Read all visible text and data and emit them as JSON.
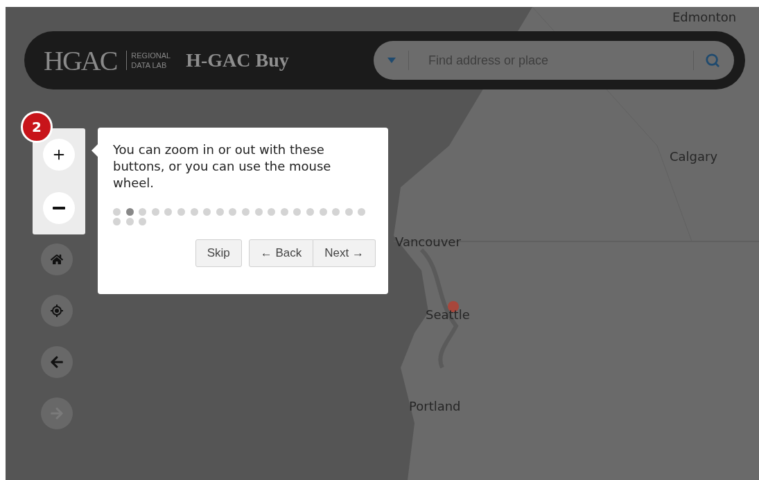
{
  "header": {
    "logo_mark": "HGAC",
    "logo_line1": "REGIONAL",
    "logo_line2": "DATA LAB",
    "title": "H-GAC Buy",
    "search": {
      "placeholder": "Find address or place"
    }
  },
  "map_labels": [
    {
      "kind": "city",
      "text": "Edmonton"
    },
    {
      "kind": "city",
      "text": "Calgary"
    },
    {
      "kind": "city",
      "text": "Vancouver"
    },
    {
      "kind": "city",
      "text": "Seattle"
    },
    {
      "kind": "city",
      "text": "Portland"
    }
  ],
  "tour_badge": "2",
  "nav_buttons": [
    {
      "kind": "home",
      "disabled": false
    },
    {
      "kind": "locate",
      "disabled": false
    },
    {
      "kind": "back",
      "disabled": false
    },
    {
      "kind": "forward",
      "disabled": true
    }
  ],
  "popup": {
    "text": "You can zoom in or out with these buttons, or you can use the mouse wheel.",
    "steps": [
      {
        "selected": false
      },
      {
        "selected": true
      },
      {
        "selected": false
      },
      {
        "selected": false
      },
      {
        "selected": false
      },
      {
        "selected": false
      },
      {
        "selected": false
      },
      {
        "selected": false
      },
      {
        "selected": false
      },
      {
        "selected": false
      },
      {
        "selected": false
      },
      {
        "selected": false
      },
      {
        "selected": false
      },
      {
        "selected": false
      },
      {
        "selected": false
      },
      {
        "selected": false
      },
      {
        "selected": false
      },
      {
        "selected": false
      },
      {
        "selected": false
      },
      {
        "selected": false
      },
      {
        "selected": false
      },
      {
        "selected": false
      },
      {
        "selected": false
      }
    ],
    "skip": "Skip",
    "back": "← Back",
    "next": "Next →"
  }
}
